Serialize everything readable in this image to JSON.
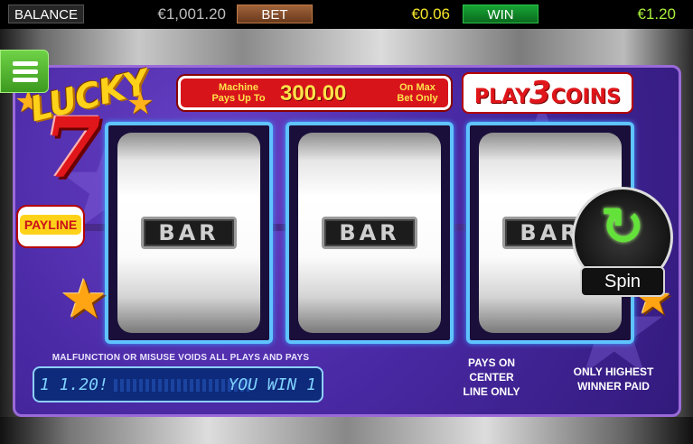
{
  "topbar": {
    "balance_label": "BALANCE",
    "balance_value": "€1,001.20",
    "bet_label": "BET",
    "bet_value": "€0.06",
    "win_label": "WIN",
    "win_value": "€1.20"
  },
  "menu": {
    "icon": "hamburger-menu-icon"
  },
  "logo": {
    "word": "LUCKY",
    "seven": "7"
  },
  "pays_banner": {
    "left_text": "Machine Pays Up To",
    "amount": "300.00",
    "right_text": "On Max Bet Only"
  },
  "play_coins": {
    "play": "PLAY",
    "number": "3",
    "coins": "COINS"
  },
  "payline_label": "PAYLINE",
  "reels": [
    {
      "symbol": "BAR"
    },
    {
      "symbol": "BAR"
    },
    {
      "symbol": "BAR"
    }
  ],
  "spin": {
    "label": "Spin",
    "icon": "refresh-arrow-icon",
    "color": "#63e23a"
  },
  "malfunction_text": "MALFUNCTION OR MISUSE VOIDS ALL PLAYS AND PAYS",
  "led_display": {
    "amount": "1 1.20!",
    "message": "YOU WIN 1"
  },
  "pays_center_text": "PAYS ON CENTER LINE ONLY",
  "highest_winner_text": "ONLY HIGHEST WINNER PAID",
  "colors": {
    "panel": "#4b2aa6",
    "reel_border": "#5fc3ff",
    "banner_red": "#d8141b",
    "accent_yellow": "#ffe14a"
  }
}
